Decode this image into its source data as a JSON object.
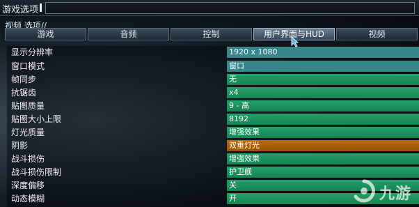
{
  "window": {
    "title": "游戏选项"
  },
  "panel": {
    "label": "视频 选项//"
  },
  "tabs": [
    {
      "label": "游戏"
    },
    {
      "label": "音频"
    },
    {
      "label": "控制"
    },
    {
      "label": "用户界面与HUD"
    },
    {
      "label": "视频"
    }
  ],
  "active_tab": "用户界面与HUD",
  "settings": [
    {
      "label": "显示分辨率",
      "value": "1920 x 1080",
      "style": "teal"
    },
    {
      "label": "窗口模式",
      "value": "窗口",
      "style": "teal"
    },
    {
      "label": "帧同步",
      "value": "无",
      "style": "green"
    },
    {
      "label": "抗锯齿",
      "value": "x4",
      "style": "green"
    },
    {
      "label": "贴图质量",
      "value": "9 - 高",
      "style": "green"
    },
    {
      "label": "贴图大小上限",
      "value": "8192",
      "style": "green"
    },
    {
      "label": "灯光质量",
      "value": "增强效果",
      "style": "green"
    },
    {
      "label": "阴影",
      "value": "双重灯光",
      "style": "orange"
    },
    {
      "label": "战斗损伤",
      "value": "增强效果",
      "style": "green"
    },
    {
      "label": "战斗损伤限制",
      "value": "护卫舰",
      "style": "green"
    },
    {
      "label": "深度偏移",
      "value": "关",
      "style": "green"
    },
    {
      "label": "动态模糊",
      "value": "开",
      "style": "green"
    }
  ],
  "colors": {
    "teal": "#37878a",
    "green": "#1f9460",
    "orange": "#a95e09"
  },
  "icons": {
    "pointer": "mouse-pointer-icon",
    "watermark": "jiuyou-logo-icon"
  },
  "watermark": {
    "text": "九游"
  }
}
